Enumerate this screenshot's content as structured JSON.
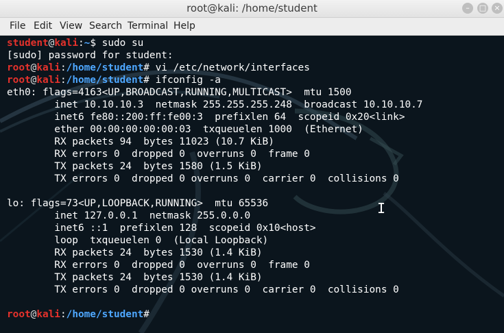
{
  "window": {
    "title": "root@kali: /home/student",
    "minimize_symbol": "–",
    "maximize_symbol": "□",
    "close_symbol": "×"
  },
  "menu": [
    "File",
    "Edit",
    "View",
    "Search",
    "Terminal",
    "Help"
  ],
  "terminal": {
    "lines": [
      {
        "kind": "prompt",
        "user": "student",
        "at": "@",
        "host": "kali",
        "sep": ":",
        "path": "~",
        "sym": "$ ",
        "cmd": "sudo su"
      },
      {
        "kind": "text",
        "text": "[sudo] password for student:"
      },
      {
        "kind": "prompt",
        "user": "root",
        "at": "@",
        "host": "kali",
        "sep": ":",
        "path": "/home/student",
        "sym": "# ",
        "cmd": "vi /etc/network/interfaces"
      },
      {
        "kind": "prompt",
        "user": "root",
        "at": "@",
        "host": "kali",
        "sep": ":",
        "path": "/home/student",
        "sym": "# ",
        "cmd": "ifconfig -a"
      },
      {
        "kind": "text",
        "text": "eth0: flags=4163<UP,BROADCAST,RUNNING,MULTICAST>  mtu 1500"
      },
      {
        "kind": "text",
        "text": "        inet 10.10.10.3  netmask 255.255.255.248  broadcast 10.10.10.7"
      },
      {
        "kind": "text",
        "text": "        inet6 fe80::200:ff:fe00:3  prefixlen 64  scopeid 0x20<link>"
      },
      {
        "kind": "text",
        "text": "        ether 00:00:00:00:00:03  txqueuelen 1000  (Ethernet)"
      },
      {
        "kind": "text",
        "text": "        RX packets 94  bytes 11023 (10.7 KiB)"
      },
      {
        "kind": "text",
        "text": "        RX errors 0  dropped 0  overruns 0  frame 0"
      },
      {
        "kind": "text",
        "text": "        TX packets 24  bytes 1580 (1.5 KiB)"
      },
      {
        "kind": "text",
        "text": "        TX errors 0  dropped 0 overruns 0  carrier 0  collisions 0"
      },
      {
        "kind": "text",
        "text": ""
      },
      {
        "kind": "text",
        "text": "lo: flags=73<UP,LOOPBACK,RUNNING>  mtu 65536"
      },
      {
        "kind": "text",
        "text": "        inet 127.0.0.1  netmask 255.0.0.0"
      },
      {
        "kind": "text",
        "text": "        inet6 ::1  prefixlen 128  scopeid 0x10<host>"
      },
      {
        "kind": "text",
        "text": "        loop  txqueuelen 0  (Local Loopback)"
      },
      {
        "kind": "text",
        "text": "        RX packets 24  bytes 1530 (1.4 KiB)"
      },
      {
        "kind": "text",
        "text": "        RX errors 0  dropped 0  overruns 0  frame 0"
      },
      {
        "kind": "text",
        "text": "        TX packets 24  bytes 1530 (1.4 KiB)"
      },
      {
        "kind": "text",
        "text": "        TX errors 0  dropped 0 overruns 0  carrier 0  collisions 0"
      },
      {
        "kind": "text",
        "text": ""
      },
      {
        "kind": "prompt",
        "user": "root",
        "at": "@",
        "host": "kali",
        "sep": ":",
        "path": "/home/student",
        "sym": "#",
        "cmd": ""
      }
    ],
    "mouse_cursor_glyph": "I"
  },
  "colors": {
    "background": "#0b151d",
    "prompt_user": "#e5322c",
    "prompt_path": "#4ea7ff",
    "text": "#ffffff"
  }
}
